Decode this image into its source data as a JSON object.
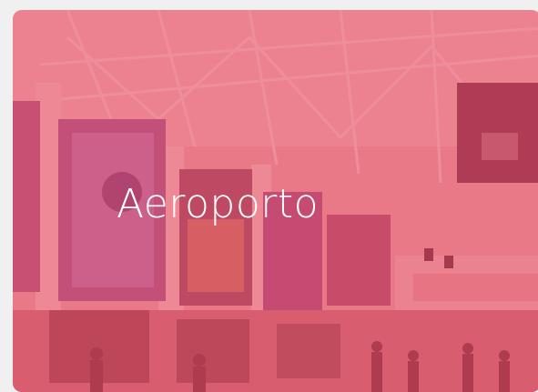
{
  "card": {
    "title": "Aeroporto",
    "background_subject": "airport-terminal-photo",
    "overlay_color": "#e5485c"
  }
}
